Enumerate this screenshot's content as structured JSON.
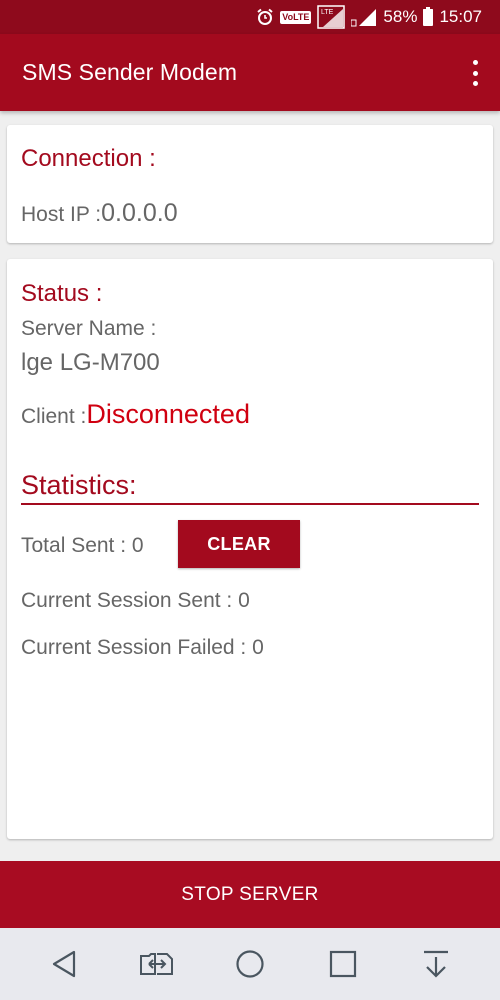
{
  "status_bar": {
    "volte_label": "VoLTE",
    "lte_label": "LTE",
    "battery_percent": "58%",
    "time": "15:07"
  },
  "app_bar": {
    "title": "SMS Sender Modem"
  },
  "connection": {
    "title": "Connection :",
    "host_ip_label": "Host IP :",
    "host_ip_value": "0.0.0.0"
  },
  "status": {
    "title": "Status :",
    "server_name_label": "Server Name :",
    "server_name_value": "lge LG-M700",
    "client_label": "Client :",
    "client_value": "Disconnected"
  },
  "statistics": {
    "title": "Statistics:",
    "total_sent": "Total Sent : 0",
    "clear_label": "CLEAR",
    "session_sent": "Current Session Sent : 0",
    "session_failed": "Current Session Failed : 0"
  },
  "footer": {
    "stop_label": "STOP SERVER"
  },
  "colors": {
    "primary": "#a30a1e",
    "status_bar": "#8e0a1c",
    "disconnected": "#d00010"
  }
}
